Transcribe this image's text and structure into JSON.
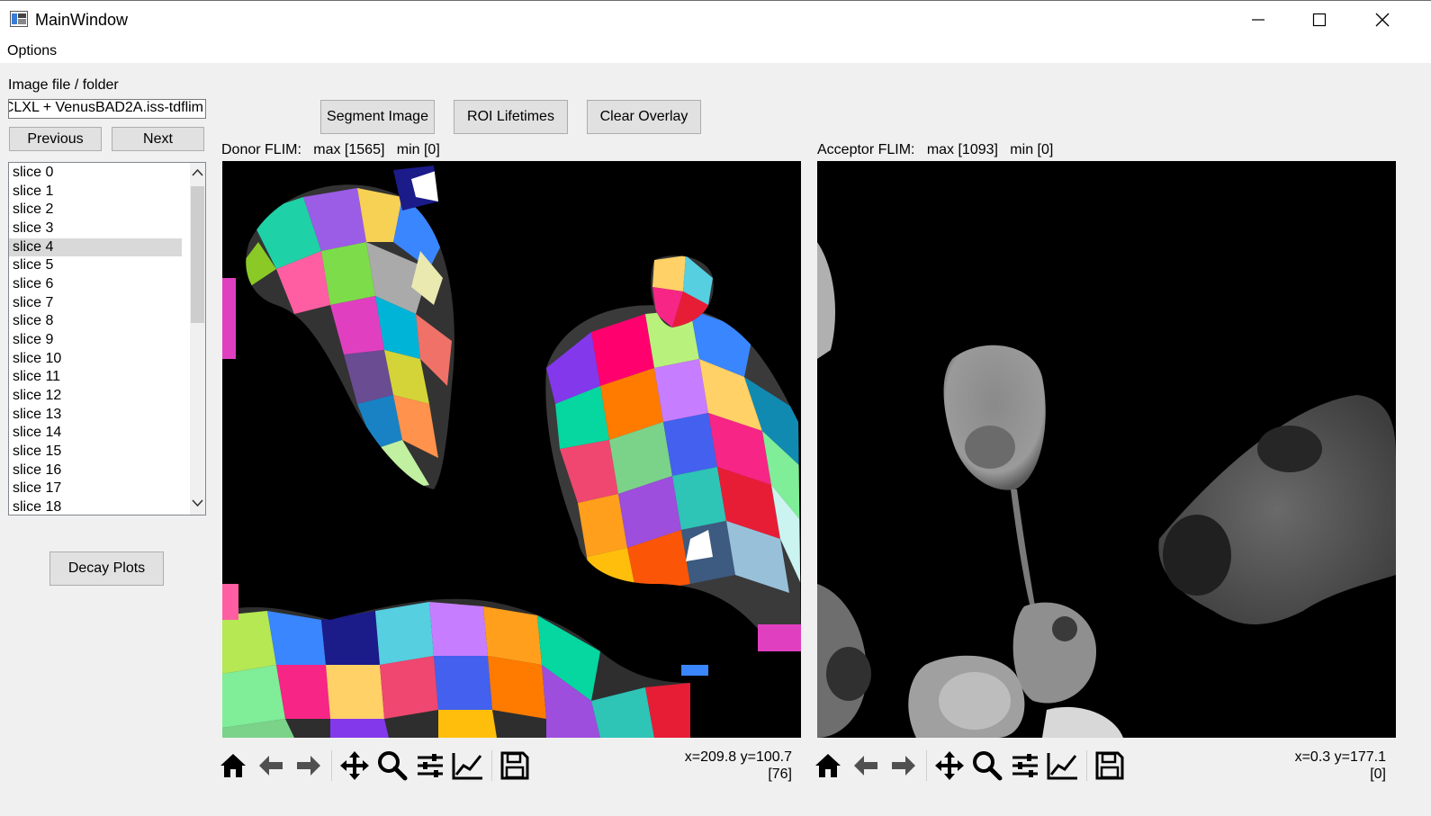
{
  "window": {
    "title": "MainWindow",
    "icons": [
      "app-icon",
      "minimize-icon",
      "maximize-icon",
      "close-icon"
    ]
  },
  "menu": {
    "options": "Options"
  },
  "left_panel": {
    "file_label": "Image file / folder",
    "file_value": "CLXL + VenusBAD2A.iss-tdflim",
    "previous": "Previous",
    "next": "Next",
    "slices": [
      "slice 0",
      "slice 1",
      "slice 2",
      "slice 3",
      "slice 4",
      "slice 5",
      "slice 6",
      "slice 7",
      "slice 8",
      "slice 9",
      "slice 10",
      "slice 11",
      "slice 12",
      "slice 13",
      "slice 14",
      "slice 15",
      "slice 16",
      "slice 17",
      "slice 18"
    ],
    "selected_slice": "slice 4",
    "decay_plots": "Decay Plots"
  },
  "actions": {
    "segment": "Segment Image",
    "roi": "ROI Lifetimes",
    "clear": "Clear Overlay"
  },
  "donor": {
    "title": "Donor FLIM:   max [1565]   min [0]",
    "coords": "x=209.8 y=100.7",
    "value": "[76]"
  },
  "acceptor": {
    "title": "Acceptor FLIM:   max [1093]   min [0]",
    "coords": "x=0.3 y=177.1",
    "value": "[0]"
  },
  "toolbar_icons": [
    "home-icon",
    "back-arrow-icon",
    "forward-arrow-icon",
    "pan-icon",
    "zoom-icon",
    "configure-subplots-icon",
    "edit-axes-icon",
    "save-icon"
  ]
}
